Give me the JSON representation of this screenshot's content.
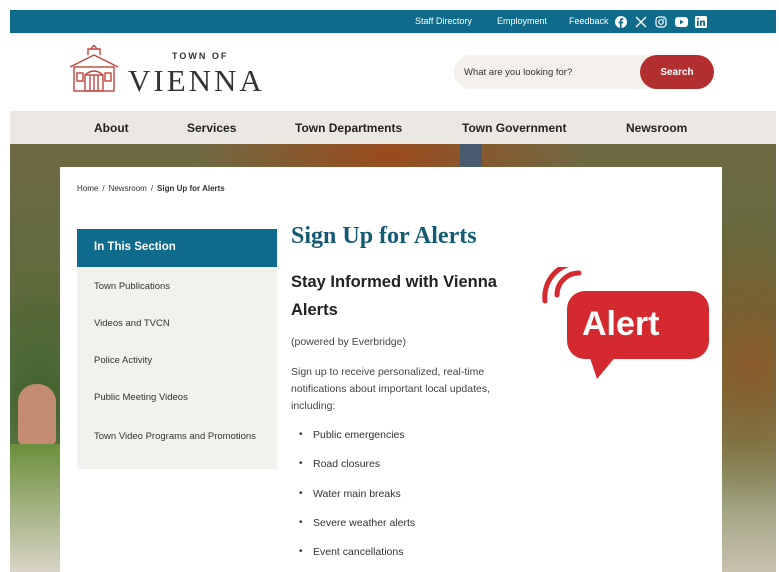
{
  "topbar": {
    "links": [
      "Staff Directory",
      "Employment",
      "Feedback"
    ],
    "social_icons": [
      "facebook-icon",
      "x-icon",
      "instagram-icon",
      "youtube-icon",
      "linkedin-icon"
    ]
  },
  "logo": {
    "town_of": "TOWN OF",
    "name": "VIENNA"
  },
  "search": {
    "placeholder": "What are you looking for?",
    "button": "Search"
  },
  "nav": [
    "About",
    "Services",
    "Town Departments",
    "Town Government",
    "Newsroom"
  ],
  "breadcrumb": [
    "Home",
    "Newsroom",
    "Sign Up for Alerts"
  ],
  "breadcrumb_separator": "/",
  "sidebar": {
    "header": "In This Section",
    "items": [
      "Town Publications",
      "Videos and TVCN",
      "Police Activity",
      "Public Meeting Videos",
      "Town Video Programs and Promotions"
    ]
  },
  "main": {
    "title": "Sign Up for Alerts",
    "subtitle": "Stay Informed with Vienna Alerts",
    "powered_by": "(powered by Everbridge)",
    "intro": "Sign up to receive personalized, real-time notifications about important local updates, including:",
    "bullets": [
      "Public emergencies",
      "Road closures",
      "Water main breaks",
      "Severe weather alerts",
      "Event cancellations"
    ],
    "alert_graphic_text": "Alert"
  },
  "colors": {
    "brand_teal": "#0e6b8c",
    "title_teal": "#135b73",
    "accent_red": "#b32e2e",
    "alert_red": "#d42a2f",
    "nav_bg": "#ebe8e4"
  }
}
